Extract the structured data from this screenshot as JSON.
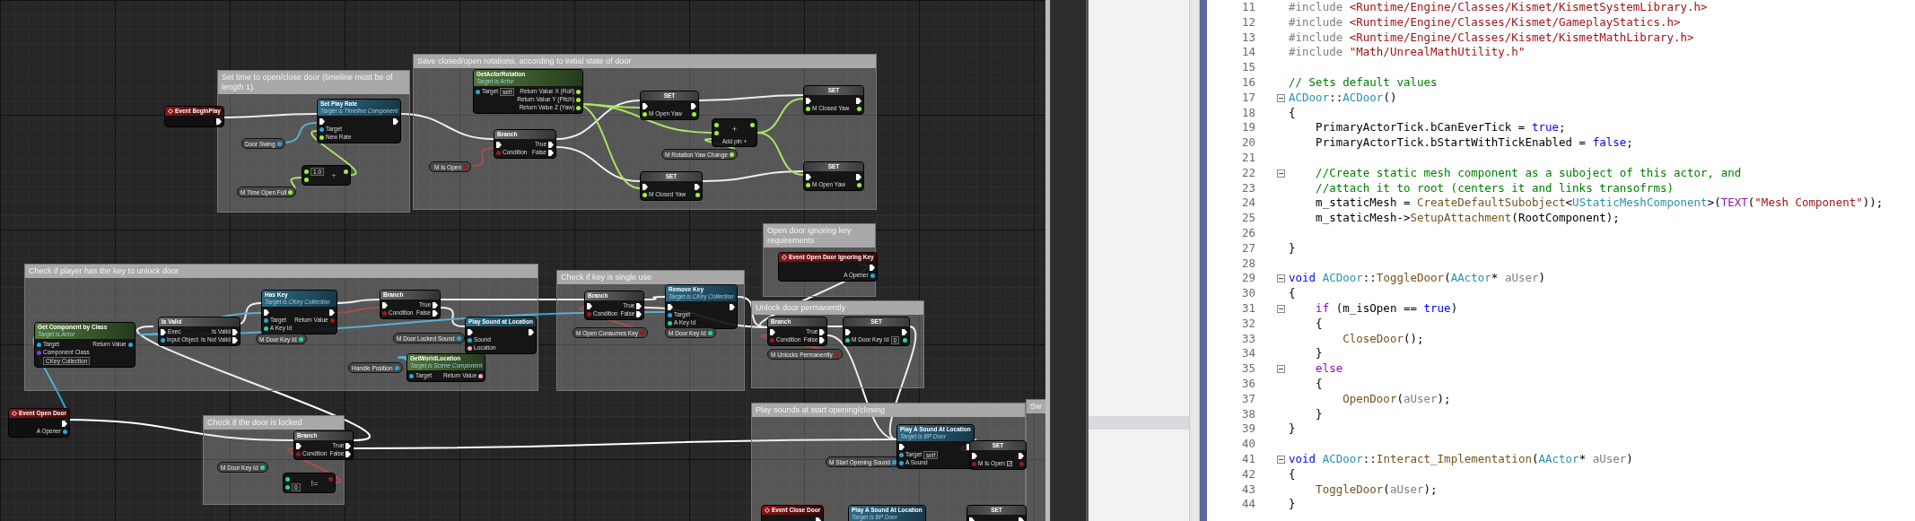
{
  "graph": {
    "comments": [
      {
        "title": "Set time to open/close door (timeline must be of length 1)."
      },
      {
        "title": "Save closed/open rotations, according to initial state of door"
      },
      {
        "title": "Check if player has the key to unlock door"
      },
      {
        "title": "Check if key is single use"
      },
      {
        "title": "Open door ignoring key requirements"
      },
      {
        "title": "Unlock door permanently"
      },
      {
        "title": "Check if the door is locked"
      },
      {
        "title": "Play sounds at start opening/closing"
      },
      {
        "title": "Sw"
      }
    ],
    "nodes": [
      {
        "kind": "event",
        "title": "Event BeginPlay",
        "outputs": [
          {
            "kind": "exec"
          }
        ]
      },
      {
        "kind": "function",
        "title": "Set Play Rate",
        "subtitle": "Target is Timeline Component",
        "inputs": [
          {
            "kind": "exec"
          },
          {
            "kind": "object",
            "label": "Target"
          },
          {
            "kind": "float",
            "label": "New Rate"
          }
        ],
        "outputs": [
          {
            "kind": "exec"
          }
        ]
      },
      {
        "kind": "variable",
        "title": "Door Swing",
        "outputs": [
          {
            "kind": "object"
          }
        ]
      },
      {
        "kind": "operator",
        "symbol": "÷",
        "inputs": [
          {
            "kind": "float",
            "value": "1.0"
          },
          {
            "kind": "float"
          }
        ],
        "outputs": [
          {
            "kind": "float"
          }
        ]
      },
      {
        "kind": "variable",
        "title": "M Time Open Full",
        "outputs": [
          {
            "kind": "float"
          }
        ]
      },
      {
        "kind": "pure",
        "title": "GetActorRotation",
        "subtitle": "Target is Actor",
        "inputs": [
          {
            "kind": "object",
            "label": "Target",
            "value": "self"
          }
        ],
        "outputs": [
          {
            "kind": "float",
            "label": "Return Value X (Roll)"
          },
          {
            "kind": "float",
            "label": "Return Value Y (Pitch)"
          },
          {
            "kind": "float",
            "label": "Return Value Z (Yaw)"
          }
        ]
      },
      {
        "kind": "branch",
        "title": "Branch",
        "inputs": [
          {
            "kind": "exec"
          },
          {
            "kind": "bool",
            "label": "Condition"
          }
        ],
        "outputs": [
          {
            "kind": "exec",
            "label": "True"
          },
          {
            "kind": "exec",
            "label": "False"
          }
        ]
      },
      {
        "kind": "variable",
        "title": "M Is Open",
        "outputs": [
          {
            "kind": "bool"
          }
        ]
      },
      {
        "kind": "set",
        "title": "SET",
        "inputs": [
          {
            "kind": "exec"
          },
          {
            "kind": "float",
            "label": "M Open Yaw"
          }
        ],
        "outputs": [
          {
            "kind": "exec"
          },
          {
            "kind": "float"
          }
        ]
      },
      {
        "kind": "operator",
        "symbol": "+",
        "footer": "Add pin +",
        "inputs": [
          {
            "kind": "float"
          },
          {
            "kind": "float"
          }
        ],
        "outputs": [
          {
            "kind": "float"
          }
        ]
      },
      {
        "kind": "variable",
        "title": "M Rotation Yaw Change",
        "outputs": [
          {
            "kind": "float"
          }
        ]
      },
      {
        "kind": "set",
        "title": "SET",
        "inputs": [
          {
            "kind": "exec"
          },
          {
            "kind": "float",
            "label": "M Closed Yaw"
          }
        ],
        "outputs": [
          {
            "kind": "exec"
          },
          {
            "kind": "float"
          }
        ]
      },
      {
        "kind": "set",
        "title": "SET",
        "inputs": [
          {
            "kind": "exec"
          },
          {
            "kind": "float",
            "label": "M Closed Yaw"
          }
        ],
        "outputs": [
          {
            "kind": "exec"
          },
          {
            "kind": "float"
          }
        ]
      },
      {
        "kind": "set",
        "title": "SET",
        "inputs": [
          {
            "kind": "exec"
          },
          {
            "kind": "float",
            "label": "M Open Yaw"
          }
        ],
        "outputs": [
          {
            "kind": "exec"
          },
          {
            "kind": "float"
          }
        ]
      },
      {
        "kind": "pure",
        "title": "Get Component by Class",
        "subtitle": "Target is Actor",
        "inputs": [
          {
            "kind": "object",
            "label": "Target"
          },
          {
            "kind": "class",
            "label": "Component Class",
            "value": "CKey Collection"
          }
        ],
        "outputs": [
          {
            "kind": "object",
            "label": "Return Value"
          }
        ]
      },
      {
        "kind": "branch",
        "title": "Is Valid",
        "inputs": [
          {
            "kind": "exec",
            "label": "Exec"
          },
          {
            "kind": "object",
            "label": "Input Object"
          }
        ],
        "outputs": [
          {
            "kind": "exec",
            "label": "Is Valid"
          },
          {
            "kind": "exec",
            "label": "Is Not Valid"
          }
        ]
      },
      {
        "kind": "function",
        "title": "Has Key",
        "subtitle": "Target is CKey Collection",
        "inputs": [
          {
            "kind": "exec"
          },
          {
            "kind": "object",
            "label": "Target"
          },
          {
            "kind": "int",
            "label": "A Key Id"
          }
        ],
        "outputs": [
          {
            "kind": "exec"
          },
          {
            "kind": "bool",
            "label": "Return Value"
          }
        ]
      },
      {
        "kind": "variable",
        "title": "M Door Key Id",
        "outputs": [
          {
            "kind": "int"
          }
        ]
      },
      {
        "kind": "branch",
        "title": "Branch",
        "inputs": [
          {
            "kind": "exec"
          },
          {
            "kind": "bool",
            "label": "Condition"
          }
        ],
        "outputs": [
          {
            "kind": "exec",
            "label": "True"
          },
          {
            "kind": "exec",
            "label": "False"
          }
        ]
      },
      {
        "kind": "function",
        "title": "Play Sound at Location",
        "inputs": [
          {
            "kind": "exec"
          },
          {
            "kind": "object",
            "label": "Sound"
          },
          {
            "kind": "struct",
            "label": "Location"
          }
        ],
        "outputs": [
          {
            "kind": "exec"
          }
        ]
      },
      {
        "kind": "variable",
        "title": "M Door Locked Sound",
        "outputs": [
          {
            "kind": "object"
          }
        ]
      },
      {
        "kind": "variable",
        "title": "Handle Position",
        "outputs": [
          {
            "kind": "object"
          }
        ]
      },
      {
        "kind": "pure",
        "title": "GetWorldLocation",
        "subtitle": "Target is Scene Component",
        "inputs": [
          {
            "kind": "object",
            "label": "Target"
          }
        ],
        "outputs": [
          {
            "kind": "struct",
            "label": "Return Value"
          }
        ]
      },
      {
        "kind": "event",
        "title": "Event Open Door",
        "outputs": [
          {
            "kind": "exec"
          },
          {
            "kind": "object",
            "label": "A Opener"
          }
        ]
      },
      {
        "kind": "branch",
        "title": "Branch",
        "inputs": [
          {
            "kind": "exec"
          },
          {
            "kind": "bool",
            "label": "Condition"
          }
        ],
        "outputs": [
          {
            "kind": "exec",
            "label": "True"
          },
          {
            "kind": "exec",
            "label": "False"
          }
        ]
      },
      {
        "kind": "variable",
        "title": "M Door Key Id",
        "outputs": [
          {
            "kind": "int"
          }
        ]
      },
      {
        "kind": "operator",
        "symbol": "!=",
        "inputs": [
          {
            "kind": "int"
          },
          {
            "kind": "int",
            "value": "0"
          }
        ],
        "outputs": [
          {
            "kind": "bool"
          }
        ]
      },
      {
        "kind": "branch",
        "title": "Branch",
        "inputs": [
          {
            "kind": "exec"
          },
          {
            "kind": "bool",
            "label": "Condition"
          }
        ],
        "outputs": [
          {
            "kind": "exec",
            "label": "True"
          },
          {
            "kind": "exec",
            "label": "False"
          }
        ]
      },
      {
        "kind": "variable",
        "title": "M Open Consumes Key",
        "outputs": [
          {
            "kind": "bool"
          }
        ]
      },
      {
        "kind": "function",
        "title": "Remove Key",
        "subtitle": "Target is CKey Collection",
        "inputs": [
          {
            "kind": "exec"
          },
          {
            "kind": "object",
            "label": "Target"
          },
          {
            "kind": "int",
            "label": "A Key Id"
          }
        ],
        "outputs": [
          {
            "kind": "exec"
          }
        ]
      },
      {
        "kind": "variable",
        "title": "M Door Key Id",
        "outputs": [
          {
            "kind": "int"
          }
        ]
      },
      {
        "kind": "event",
        "title": "Event Open Door Ignoring Key",
        "outputs": [
          {
            "kind": "exec"
          },
          {
            "kind": "object",
            "label": "A Opener"
          }
        ]
      },
      {
        "kind": "branch",
        "title": "Branch",
        "inputs": [
          {
            "kind": "exec"
          },
          {
            "kind": "bool",
            "label": "Condition"
          }
        ],
        "outputs": [
          {
            "kind": "exec",
            "label": "True"
          },
          {
            "kind": "exec",
            "label": "False"
          }
        ]
      },
      {
        "kind": "set",
        "title": "SET",
        "inputs": [
          {
            "kind": "exec"
          },
          {
            "kind": "int",
            "label": "M Door Key Id",
            "value": "0"
          }
        ],
        "outputs": [
          {
            "kind": "exec"
          },
          {
            "kind": "int"
          }
        ]
      },
      {
        "kind": "variable",
        "title": "M Unlocks Permanently",
        "outputs": [
          {
            "kind": "bool"
          }
        ]
      },
      {
        "kind": "variable",
        "title": "M Start Opening Sound",
        "outputs": [
          {
            "kind": "object"
          }
        ]
      },
      {
        "kind": "function",
        "title": "Play A Sound At Location",
        "subtitle": "Target is BP Door",
        "inputs": [
          {
            "kind": "exec"
          },
          {
            "kind": "object",
            "label": "Target",
            "value": "self"
          },
          {
            "kind": "object",
            "label": "A Sound"
          }
        ],
        "outputs": [
          {
            "kind": "exec"
          }
        ]
      },
      {
        "kind": "set",
        "title": "SET",
        "inputs": [
          {
            "kind": "exec"
          },
          {
            "kind": "bool",
            "label": "M Is Open",
            "checked": true
          }
        ],
        "outputs": [
          {
            "kind": "exec"
          },
          {
            "kind": "bool"
          }
        ]
      },
      {
        "kind": "event",
        "title": "Event Close Door",
        "outputs": [
          {
            "kind": "exec"
          }
        ]
      },
      {
        "kind": "function",
        "title": "Play A Sound At Location",
        "subtitle": "Target is BP Door",
        "inputs": [
          {
            "kind": "exec"
          }
        ],
        "outputs": [
          {
            "kind": "exec"
          }
        ]
      },
      {
        "kind": "set",
        "title": "SET",
        "inputs": [
          {
            "kind": "exec"
          }
        ],
        "outputs": [
          {
            "kind": "exec"
          }
        ]
      }
    ]
  },
  "editor": {
    "lines": [
      {
        "number": "11",
        "tokens": [
          {
            "kind": "preprocessor",
            "text": "#include "
          },
          {
            "kind": "string",
            "text": "<Runtime/Engine/Classes/Kismet/KismetSystemLibrary.h>"
          }
        ]
      },
      {
        "number": "12",
        "tokens": [
          {
            "kind": "preprocessor",
            "text": "#include "
          },
          {
            "kind": "string",
            "text": "<Runtime/Engine/Classes/Kismet/GameplayStatics.h>"
          }
        ]
      },
      {
        "number": "13",
        "tokens": [
          {
            "kind": "preprocessor",
            "text": "#include "
          },
          {
            "kind": "string",
            "text": "<Runtime/Engine/Classes/Kismet/KismetMathLibrary.h>"
          }
        ]
      },
      {
        "number": "14",
        "tokens": [
          {
            "kind": "preprocessor",
            "text": "#include "
          },
          {
            "kind": "string",
            "text": "\"Math/UnrealMathUtility.h\""
          }
        ]
      },
      {
        "number": "15"
      },
      {
        "number": "16",
        "tokens": [
          {
            "kind": "comment",
            "text": "// Sets default values"
          }
        ]
      },
      {
        "number": "17",
        "fold": true,
        "tokens": [
          {
            "kind": "type",
            "text": "ACDoor"
          },
          {
            "kind": "plain",
            "text": "::"
          },
          {
            "kind": "type",
            "text": "ACDoor"
          },
          {
            "kind": "plain",
            "text": "()"
          }
        ]
      },
      {
        "number": "18",
        "tokens": [
          {
            "kind": "plain",
            "text": "{"
          }
        ]
      },
      {
        "number": "19",
        "tokens": [
          {
            "kind": "plain",
            "text": "    PrimaryActorTick.bCanEverTick = "
          },
          {
            "kind": "keyword",
            "text": "true"
          },
          {
            "kind": "plain",
            "text": ";"
          }
        ]
      },
      {
        "number": "20",
        "tokens": [
          {
            "kind": "plain",
            "text": "    PrimaryActorTick.bStartWithTickEnabled = "
          },
          {
            "kind": "keyword",
            "text": "false"
          },
          {
            "kind": "plain",
            "text": ";"
          }
        ]
      },
      {
        "number": "21"
      },
      {
        "number": "22",
        "fold": true,
        "tokens": [
          {
            "kind": "comment",
            "text": "    //Create static mesh component as a suboject of this actor, and"
          }
        ]
      },
      {
        "number": "23",
        "tokens": [
          {
            "kind": "comment",
            "text": "    //attach it to root (centers it and links transofrms)"
          }
        ]
      },
      {
        "number": "24",
        "tokens": [
          {
            "kind": "plain",
            "text": "    m_staticMesh = "
          },
          {
            "kind": "function",
            "text": "CreateDefaultSubobject"
          },
          {
            "kind": "plain",
            "text": "<"
          },
          {
            "kind": "type",
            "text": "UStaticMeshComponent"
          },
          {
            "kind": "plain",
            "text": ">("
          },
          {
            "kind": "macro",
            "text": "TEXT"
          },
          {
            "kind": "plain",
            "text": "("
          },
          {
            "kind": "string",
            "text": "\"Mesh Component\""
          },
          {
            "kind": "plain",
            "text": "));"
          }
        ]
      },
      {
        "number": "25",
        "tokens": [
          {
            "kind": "plain",
            "text": "    m_staticMesh->"
          },
          {
            "kind": "function",
            "text": "SetupAttachment"
          },
          {
            "kind": "plain",
            "text": "(RootComponent);"
          }
        ]
      },
      {
        "number": "26"
      },
      {
        "number": "27",
        "tokens": [
          {
            "kind": "plain",
            "text": "}"
          }
        ]
      },
      {
        "number": "28"
      },
      {
        "number": "29",
        "fold": true,
        "tokens": [
          {
            "kind": "keyword",
            "text": "void "
          },
          {
            "kind": "type",
            "text": "ACDoor"
          },
          {
            "kind": "plain",
            "text": "::"
          },
          {
            "kind": "function",
            "text": "ToggleDoor"
          },
          {
            "kind": "plain",
            "text": "("
          },
          {
            "kind": "type",
            "text": "AActor"
          },
          {
            "kind": "plain",
            "text": "* "
          },
          {
            "kind": "param",
            "text": "aUser"
          },
          {
            "kind": "plain",
            "text": ")"
          }
        ]
      },
      {
        "number": "30",
        "tokens": [
          {
            "kind": "plain",
            "text": "{"
          }
        ]
      },
      {
        "number": "31",
        "fold": true,
        "tokens": [
          {
            "kind": "control",
            "text": "    if"
          },
          {
            "kind": "plain",
            "text": " (m_isOpen == "
          },
          {
            "kind": "keyword",
            "text": "true"
          },
          {
            "kind": "plain",
            "text": ")"
          }
        ]
      },
      {
        "number": "32",
        "tokens": [
          {
            "kind": "plain",
            "text": "    {"
          }
        ]
      },
      {
        "number": "33",
        "tokens": [
          {
            "kind": "function",
            "text": "        CloseDoor"
          },
          {
            "kind": "plain",
            "text": "();"
          }
        ]
      },
      {
        "number": "34",
        "tokens": [
          {
            "kind": "plain",
            "text": "    }"
          }
        ]
      },
      {
        "number": "35",
        "fold": true,
        "tokens": [
          {
            "kind": "control",
            "text": "    else"
          }
        ]
      },
      {
        "number": "36",
        "tokens": [
          {
            "kind": "plain",
            "text": "    {"
          }
        ]
      },
      {
        "number": "37",
        "tokens": [
          {
            "kind": "function",
            "text": "        OpenDoor"
          },
          {
            "kind": "plain",
            "text": "("
          },
          {
            "kind": "param",
            "text": "aUser"
          },
          {
            "kind": "plain",
            "text": ");"
          }
        ]
      },
      {
        "number": "38",
        "tokens": [
          {
            "kind": "plain",
            "text": "    }"
          }
        ]
      },
      {
        "number": "39",
        "tokens": [
          {
            "kind": "plain",
            "text": "}"
          }
        ]
      },
      {
        "number": "40"
      },
      {
        "number": "41",
        "fold": true,
        "tokens": [
          {
            "kind": "keyword",
            "text": "void "
          },
          {
            "kind": "type",
            "text": "ACDoor"
          },
          {
            "kind": "plain",
            "text": "::"
          },
          {
            "kind": "function",
            "text": "Interact_Implementation"
          },
          {
            "kind": "plain",
            "text": "("
          },
          {
            "kind": "type",
            "text": "AActor"
          },
          {
            "kind": "plain",
            "text": "* "
          },
          {
            "kind": "param",
            "text": "aUser"
          },
          {
            "kind": "plain",
            "text": ")"
          }
        ]
      },
      {
        "number": "42",
        "tokens": [
          {
            "kind": "plain",
            "text": "{"
          }
        ]
      },
      {
        "number": "43",
        "tokens": [
          {
            "kind": "function",
            "text": "    ToggleDoor"
          },
          {
            "kind": "plain",
            "text": "("
          },
          {
            "kind": "param",
            "text": "aUser"
          },
          {
            "kind": "plain",
            "text": ");"
          }
        ]
      },
      {
        "number": "44",
        "tokens": [
          {
            "kind": "plain",
            "text": "}"
          }
        ]
      }
    ]
  }
}
